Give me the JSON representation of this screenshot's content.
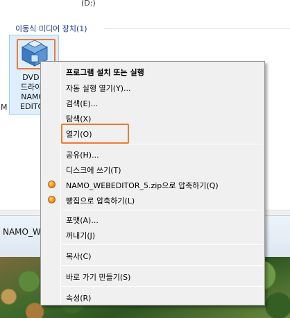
{
  "explorer": {
    "drive_label": "(D:)",
    "group_header": "이동식 미디어 장치(1)",
    "dvd_item_label": "DVD R\n드라이브\nNAMO_\nEDITOR",
    "truncated_text": "M"
  },
  "details_pane": {
    "name": "NAMO_W"
  },
  "context_menu": {
    "items": [
      {
        "label": "프로그램 설치 또는 실행",
        "bold": true
      },
      {
        "label": "자동 실행 열기(Y)..."
      },
      {
        "label": "검색(E)..."
      },
      {
        "label": "탐색(X)"
      },
      {
        "label": "열기(O)"
      },
      {
        "label": "공유(H)..."
      },
      {
        "label": "디스크에 쓰기(T)"
      },
      {
        "label": "NAMO_WEBEDITOR_5.zip으로 압축하기(Q)",
        "icon": "bandizip-icon"
      },
      {
        "label": "빵집으로 압축하기(L)",
        "icon": "bandizip-icon"
      },
      {
        "label": "포맷(A)..."
      },
      {
        "label": "꺼내기(J)"
      },
      {
        "label": "복사(C)"
      },
      {
        "label": "바로 가기 만들기(S)"
      },
      {
        "label": "속성(R)"
      }
    ]
  },
  "colors": {
    "highlight": "#f07a2c",
    "menu_background": "#f0f0f0",
    "selection": "#dfeefc",
    "group_header": "#1e3287"
  }
}
